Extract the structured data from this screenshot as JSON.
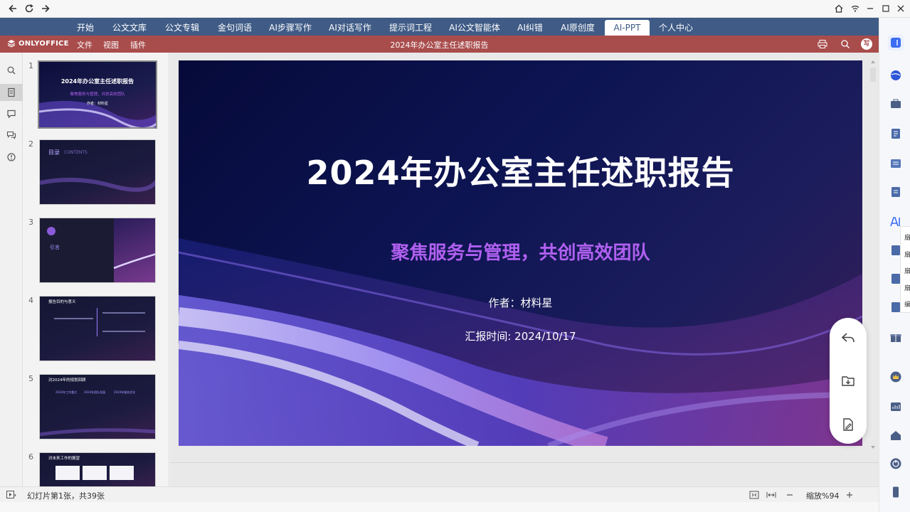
{
  "browser": {
    "back": "←",
    "reload": "⟳",
    "forward": "→"
  },
  "nav": {
    "tabs": [
      "开始",
      "公文文库",
      "公文专辑",
      "金句词语",
      "AI步骤写作",
      "AI对话写作",
      "提示词工程",
      "AI公文智能体",
      "AI纠错",
      "AI原创度",
      "AI-PPT",
      "个人中心"
    ],
    "active": "AI-PPT"
  },
  "editor_bar": {
    "logo": "ONLYOFFICE",
    "menus": [
      "文件",
      "视图",
      "插件"
    ],
    "doc_title": "2024年办公室主任述职报告",
    "avatar": "写"
  },
  "thumbnails": {
    "numbers": [
      "1",
      "2",
      "3",
      "4",
      "5",
      "6"
    ],
    "t1_title": "2024年办公室主任述职报告",
    "t1_sub": "聚焦服务与管理，共创高效团队",
    "t1_author": "作者：材料星",
    "t2_title": "目录",
    "t2_en": "CONTENTS",
    "t3_label": "引言",
    "t4_title": "报告目的与意义",
    "t5_title": "对2024年的规划回顾",
    "t5_cols": [
      "2024年工作重点",
      "2024年团队发展",
      "2024年服务优化"
    ],
    "t6_title": "对未来工作的展望"
  },
  "slide": {
    "title": "2024年办公室主任述职报告",
    "subtitle": "聚焦服务与管理，共创高效团队",
    "author": "作者：材料星",
    "date": "汇报时间: 2024/10/17"
  },
  "status": {
    "slide_info": "幻灯片第1张，共39张",
    "zoom": "缩放%94"
  },
  "right_popup": [
    "扇",
    "扇",
    "扇",
    "扇",
    "编"
  ],
  "colors": {
    "nav_bg": "#3f5b86",
    "editor_bar_bg": "#a94c4c",
    "subtitle": "#b060f0"
  }
}
